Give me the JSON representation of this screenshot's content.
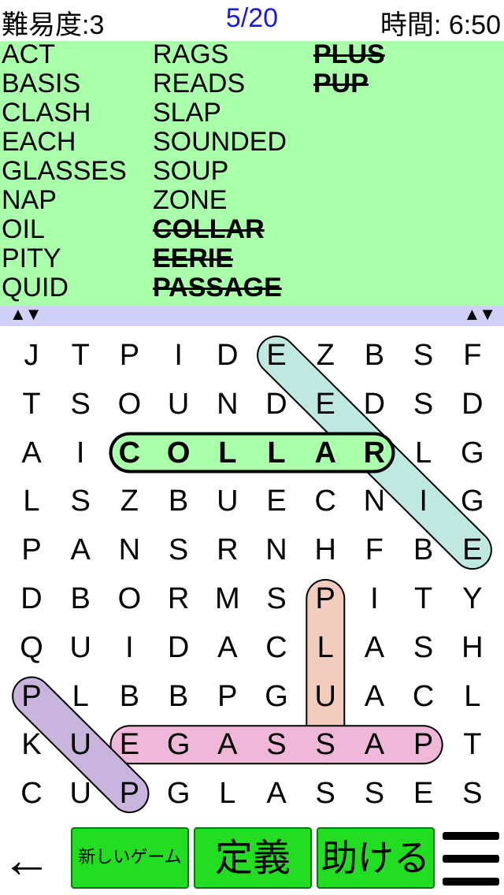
{
  "header": {
    "difficulty": "難易度:3",
    "progress": "5/20",
    "timer": "時間: 6:50"
  },
  "words": [
    {
      "text": "ACT",
      "found": false
    },
    {
      "text": "BASIS",
      "found": false
    },
    {
      "text": "CLASH",
      "found": false
    },
    {
      "text": "EACH",
      "found": false
    },
    {
      "text": "GLASSES",
      "found": false
    },
    {
      "text": "NAP",
      "found": false
    },
    {
      "text": "OIL",
      "found": false
    },
    {
      "text": "PITY",
      "found": false
    },
    {
      "text": "QUID",
      "found": false
    },
    {
      "text": "RAGS",
      "found": false
    },
    {
      "text": "READS",
      "found": false
    },
    {
      "text": "SLAP",
      "found": false
    },
    {
      "text": "SOUNDED",
      "found": false
    },
    {
      "text": "SOUP",
      "found": false
    },
    {
      "text": "ZONE",
      "found": false
    },
    {
      "text": "COLLAR",
      "found": true
    },
    {
      "text": "EERIE",
      "found": true
    },
    {
      "text": "PASSAGE",
      "found": true
    },
    {
      "text": "PLUS",
      "found": true
    },
    {
      "text": "PUP",
      "found": true
    }
  ],
  "scroll_arrows": "▲▼",
  "grid": [
    "JTPIDEZBSF",
    "TSOUNDEDSD",
    "AICOLLARLG",
    "LSZBUECNIG",
    "PANSRNHFBE",
    "DBORMSPITY",
    "QUIDACLASH",
    "PLBBPGUACL",
    "KUEGASSAPT",
    "CUPGLASSES"
  ],
  "highlights": [
    {
      "word": "EERIE",
      "from": [
        0,
        5
      ],
      "to": [
        4,
        9
      ],
      "color": "#bfe9e0"
    },
    {
      "word": "COLLAR",
      "from": [
        2,
        2
      ],
      "to": [
        2,
        7
      ],
      "color": "#aaffaa"
    },
    {
      "word": "PLUS",
      "from": [
        5,
        6
      ],
      "to": [
        8,
        6
      ],
      "color": "#f2ccbd"
    },
    {
      "word": "PASSAGE",
      "from": [
        8,
        8
      ],
      "to": [
        8,
        2
      ],
      "color": "#f0b8d8"
    },
    {
      "word": "PUP",
      "from": [
        7,
        0
      ],
      "to": [
        9,
        2
      ],
      "color": "#c8b4dc"
    }
  ],
  "active_highlight": "COLLAR",
  "bottom": {
    "back_icon": "←",
    "new_game": "新しいゲーム",
    "define": "定義",
    "help": "助ける",
    "menu_icon": "hamburger-menu-icon"
  }
}
